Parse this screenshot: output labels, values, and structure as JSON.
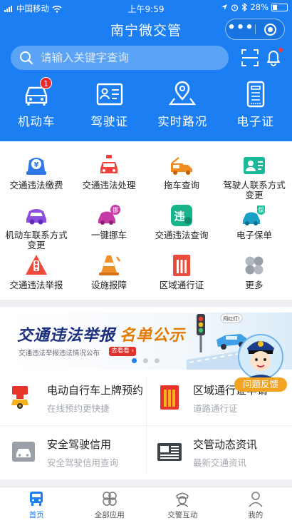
{
  "status_bar": {
    "carrier": "中国移动",
    "time": "上午9:59",
    "battery": "28%"
  },
  "header": {
    "title": "南宁微交管",
    "capsule_more": "•••"
  },
  "search": {
    "placeholder": "请输入关键字查询"
  },
  "top_nav": [
    {
      "label": "机动车",
      "badge": "1",
      "icon": "car-icon"
    },
    {
      "label": "驾驶证",
      "icon": "license-card-icon"
    },
    {
      "label": "实时路况",
      "icon": "location-pin-icon"
    },
    {
      "label": "电子证",
      "icon": "e-certificate-icon"
    }
  ],
  "services": [
    {
      "label": "交通违法缴费",
      "icon": "fine-payment-icon",
      "color": "#2f78e8"
    },
    {
      "label": "交通违法处理",
      "icon": "car-violation-icon",
      "color": "#f0413c"
    },
    {
      "label": "拖车查询",
      "icon": "tow-truck-icon",
      "color": "#f08a1e"
    },
    {
      "label": "驾驶人联系方式变更",
      "line1": "驾驶人联系方式",
      "line2": "变更",
      "icon": "driver-contact-icon",
      "color": "#19b99a"
    },
    {
      "label": "机动车联系方式变更",
      "line1": "机动车联系方式",
      "line2": "变更",
      "icon": "vehicle-contact-icon",
      "color": "#8a4fe0"
    },
    {
      "label": "一键挪车",
      "icon": "move-car-icon",
      "color": "#c73aa5",
      "tag": "挪"
    },
    {
      "label": "交通违法查询",
      "icon": "violation-query-icon",
      "color": "#17b38a",
      "tag": "违"
    },
    {
      "label": "电子保单",
      "icon": "e-insurance-icon",
      "color": "#19a0c8",
      "tag": "保"
    },
    {
      "label": "交通违法举报",
      "icon": "violation-report-icon",
      "color": "#ef4a3b"
    },
    {
      "label": "设施报障",
      "icon": "traffic-cone-icon",
      "color": "#f0902a"
    },
    {
      "label": "区域通行证",
      "icon": "area-pass-icon",
      "color": "#ea4b3c"
    },
    {
      "label": "更多",
      "icon": "more-petals-icon",
      "color": "#9aa0a8"
    }
  ],
  "banner": {
    "headline": "交通违法举报",
    "headline_highlight": "名单公示",
    "subtitle": "交通违法举报违法情况公布",
    "button": "去看看 ›",
    "bubble": "闯红灯!",
    "slides": 3,
    "active_slide": 1
  },
  "feedback": {
    "label": "问题反馈"
  },
  "cards": [
    {
      "title": "电动自行车上牌预约",
      "subtitle": "在线预约更快捷",
      "icon": "ebike-plate-icon"
    },
    {
      "title": "区域通行证申请",
      "subtitle": "道路通行证",
      "icon": "pass-gate-icon"
    },
    {
      "title": "安全驾驶信用",
      "subtitle": "安全驾驶信用查询",
      "icon": "safe-drive-icon"
    },
    {
      "title": "交管动态资讯",
      "subtitle": "最新交通资讯",
      "icon": "news-icon"
    }
  ],
  "tabs": [
    {
      "label": "首页",
      "icon": "home-bus-icon",
      "active": true
    },
    {
      "label": "全部应用",
      "icon": "all-apps-icon"
    },
    {
      "label": "交警互动",
      "icon": "police-interaction-icon"
    },
    {
      "label": "我的",
      "icon": "profile-icon"
    }
  ],
  "colors": {
    "primary": "#1b7ef2",
    "badge": "#f1242d",
    "feedback": "#f3a322",
    "banner_highlight": "#e27a00"
  }
}
